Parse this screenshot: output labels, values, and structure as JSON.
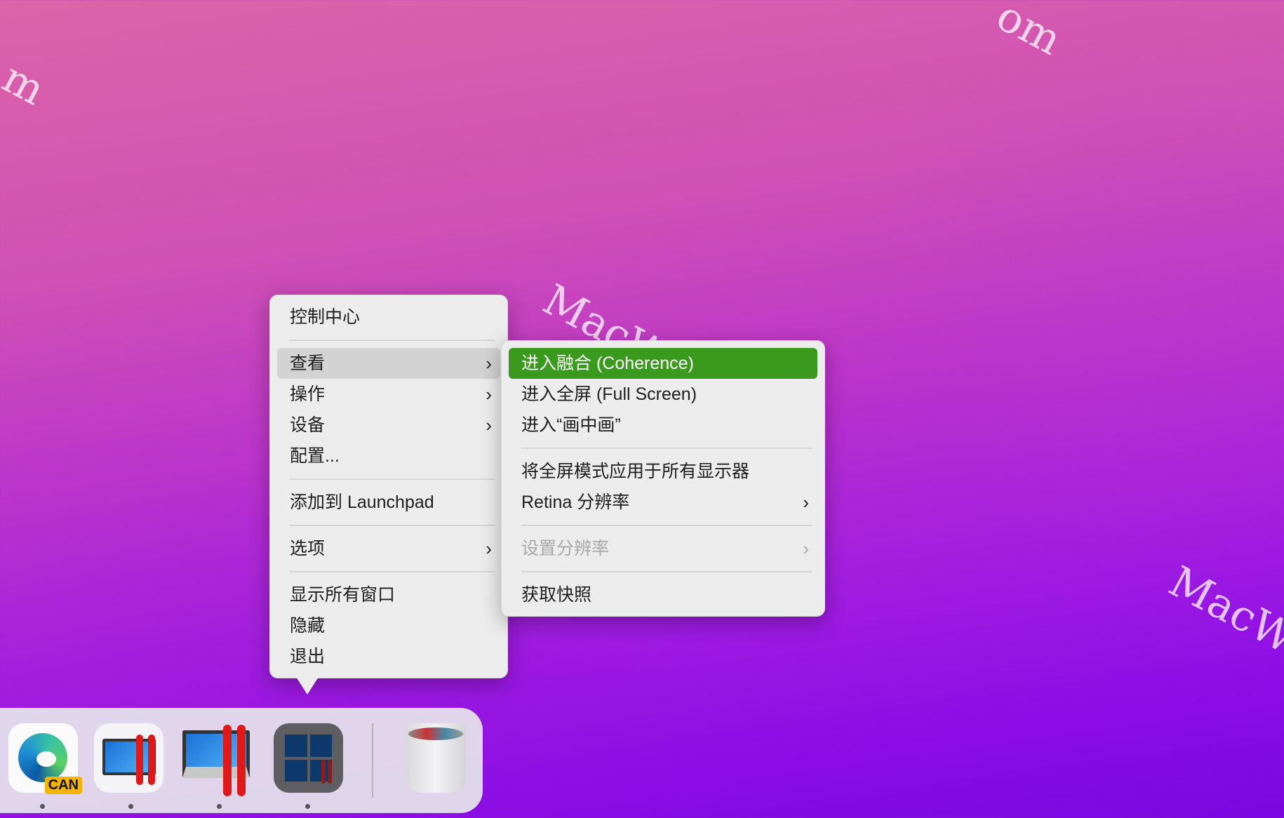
{
  "main_menu": {
    "items": [
      {
        "label": "控制中心"
      },
      {
        "label": "查看",
        "submenu": true,
        "highlighted": true
      },
      {
        "label": "操作",
        "submenu": true
      },
      {
        "label": "设备",
        "submenu": true
      },
      {
        "label": "配置..."
      },
      {
        "label": "添加到 Launchpad"
      },
      {
        "label": "选项",
        "submenu": true
      },
      {
        "label": "显示所有窗口"
      },
      {
        "label": "隐藏"
      },
      {
        "label": "退出"
      }
    ]
  },
  "sub_menu": {
    "items": [
      {
        "label": "进入融合 (Coherence)",
        "selected": true
      },
      {
        "label": "进入全屏 (Full Screen)"
      },
      {
        "label": "进入“画中画”"
      },
      {
        "label": "将全屏模式应用于所有显示器"
      },
      {
        "label": "Retina 分辨率",
        "submenu": true
      },
      {
        "label": "设置分辨率",
        "submenu": true,
        "disabled": true
      },
      {
        "label": "获取快照"
      }
    ]
  },
  "chevron": "›",
  "dock": {
    "apps": [
      {
        "name": "Microsoft Edge Canary",
        "badge": "CAN"
      },
      {
        "name": "Parallels Desktop"
      },
      {
        "name": "Windows VM"
      },
      {
        "name": "Windows 11 VM"
      },
      {
        "name": "Trash"
      }
    ]
  },
  "colors": {
    "selected": "#3a9a1e",
    "menu_bg": "#ececec"
  },
  "watermark": "MacW.com"
}
